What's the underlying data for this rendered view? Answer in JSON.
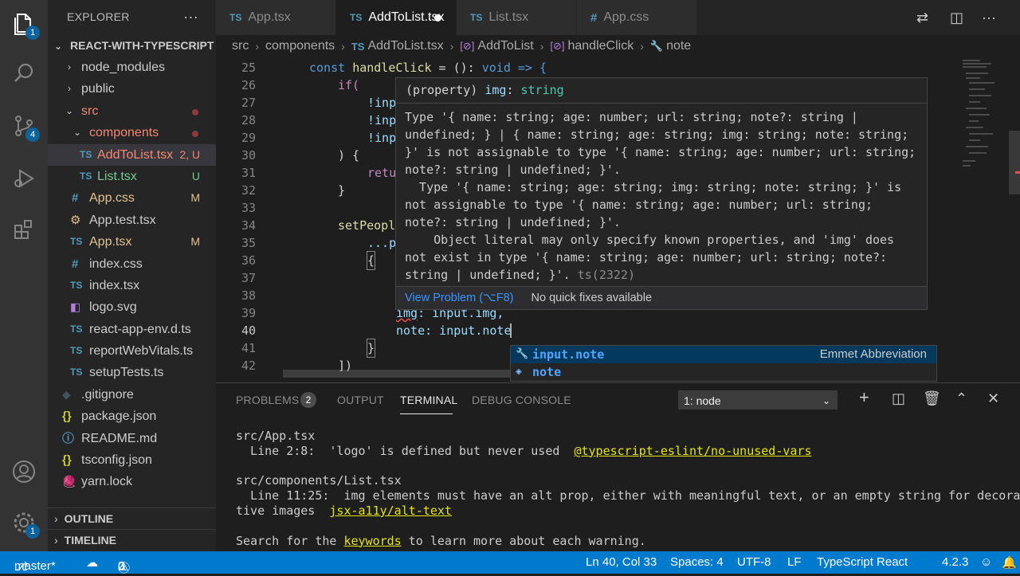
{
  "explorer": {
    "title": "EXPLORER",
    "more": "···",
    "project": "REACT-WITH-TYPESCRIPT",
    "items": [
      {
        "label": "node_modules",
        "status": ""
      },
      {
        "label": "public",
        "status": ""
      },
      {
        "label": "src",
        "status": ""
      },
      {
        "label": "components",
        "status": ""
      },
      {
        "label": "AddToList.tsx",
        "status": "2, U"
      },
      {
        "label": "List.tsx",
        "status": "U"
      },
      {
        "label": "App.css",
        "status": "M"
      },
      {
        "label": "App.test.tsx",
        "status": ""
      },
      {
        "label": "App.tsx",
        "status": "M"
      },
      {
        "label": "index.css",
        "status": ""
      },
      {
        "label": "index.tsx",
        "status": ""
      },
      {
        "label": "logo.svg",
        "status": ""
      },
      {
        "label": "react-app-env.d.ts",
        "status": ""
      },
      {
        "label": "reportWebVitals.ts",
        "status": ""
      },
      {
        "label": "setupTests.ts",
        "status": ""
      },
      {
        "label": ".gitignore",
        "status": ""
      },
      {
        "label": "package.json",
        "status": ""
      },
      {
        "label": "README.md",
        "status": ""
      },
      {
        "label": "tsconfig.json",
        "status": ""
      },
      {
        "label": "yarn.lock",
        "status": ""
      }
    ],
    "outline": "OUTLINE",
    "timeline": "TIMELINE"
  },
  "activity": {
    "explorer_badge": "1",
    "scm_badge": "4",
    "settings_badge": "1"
  },
  "tabs": [
    {
      "icon": "TS",
      "label": "App.tsx"
    },
    {
      "icon": "TS",
      "label": "AddToList.tsx"
    },
    {
      "icon": "TS",
      "label": "List.tsx"
    },
    {
      "icon": "#",
      "label": "App.css"
    }
  ],
  "breadcrumb": [
    "src",
    "components",
    "AddToList.tsx",
    "AddToList",
    "handleClick",
    "note"
  ],
  "breadcrumb_icons": {
    "file": "TS",
    "component": "[⊘]",
    "method": "[⊘]",
    "property": "🔧"
  },
  "editor": {
    "lines": [
      {
        "n": "25"
      },
      {
        "n": "26"
      },
      {
        "n": "27"
      },
      {
        "n": "28"
      },
      {
        "n": "29"
      },
      {
        "n": "30"
      },
      {
        "n": "31"
      },
      {
        "n": "32"
      },
      {
        "n": "33"
      },
      {
        "n": "34"
      },
      {
        "n": "35"
      },
      {
        "n": "36"
      },
      {
        "n": "37"
      },
      {
        "n": "38"
      },
      {
        "n": "39"
      },
      {
        "n": "40"
      },
      {
        "n": "41"
      },
      {
        "n": "42"
      }
    ],
    "code": {
      "l25_kw": "const",
      "l25_fn": "handleClick",
      "l25_mid": " = (): ",
      "l25_type": "void",
      "l25_end": " => {",
      "l26": "if(",
      "l27": "!inp",
      "l28": "!inp",
      "l29": "!inp",
      "l30": ") {",
      "l31": "retu",
      "l32": "}",
      "l34": "setPeopl",
      "l35": "...p",
      "l36": "{",
      "l39_key": "img",
      "l39_val": ": input.img,",
      "l40": "note: input.note",
      "l41": "}",
      "l42": "])"
    }
  },
  "hover": {
    "head_prefix": "(property)",
    "head_name": "img",
    "head_type": "string",
    "body": "Type '{ name: string; age: number; url: string; note?: string |\nundefined; } | { name: string; age: string; img: string; note: string;\n}' is not assignable to type '{ name: string; age: number; url: string;\nnote?: string | undefined; }'.\n  Type '{ name: string; age: string; img: string; note: string; }' is\nnot assignable to type '{ name: string; age: number; url: string;\nnote?: string | undefined; }'.\n    Object literal may only specify known properties, and 'img' does\nnot exist in type '{ name: string; age: number; url: string; note?:\nstring | undefined; }'.",
    "code": "ts(2322)",
    "view_problem": "View Problem (⌥F8)",
    "no_fixes": "No quick fixes available"
  },
  "suggest": [
    {
      "label_bold": "input.note",
      "label_rest": "",
      "detail": "Emmet Abbreviation",
      "icon": "wrench-icon"
    },
    {
      "label_bold": "note",
      "label_rest": "",
      "detail": "",
      "icon": "field-icon"
    }
  ],
  "panel": {
    "tabs": [
      "PROBLEMS",
      "OUTPUT",
      "TERMINAL",
      "DEBUG CONSOLE"
    ],
    "problems_count": "2",
    "terminal_select": "1: node",
    "terminal": {
      "f1": "src/App.tsx",
      "l1a": "  Line 2:8:  'logo' is defined but never used  ",
      "l1b": "@typescript-eslint/no-unused-vars",
      "f2": "src/components/List.tsx",
      "l2a": "  Line 11:25:  img elements must have an alt prop, either with meaningful text, or an empty string for decora",
      "l2b": "tive images  ",
      "l2c": "jsx-a11y/alt-text",
      "l3a": "Search for the ",
      "l3b": "keywords",
      "l3c": " to learn more about each warning."
    }
  },
  "status": {
    "branch": "master*",
    "errors": "2",
    "warnings": "0",
    "position": "Ln 40, Col 33",
    "spaces": "Spaces: 4",
    "encoding": "UTF-8",
    "eol": "LF",
    "language": "TypeScript React",
    "version": "4.2.3"
  },
  "colors": {
    "accent": "#007acc",
    "error": "#f48771",
    "modified": "#e2c08d",
    "untracked": "#73c991",
    "link": "#3794ff"
  }
}
